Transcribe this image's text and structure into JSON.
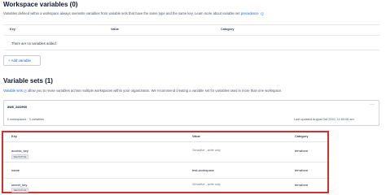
{
  "workspace_variables": {
    "title": "Workspace variables (0)",
    "description": "Variables defined within a workspace always overwrite variables from variable sets that have the same type and the same key. Learn more about variable set",
    "description_link": "precedence",
    "columns": [
      "Key",
      "Value",
      "Category"
    ],
    "empty_message": "There are no variables added.",
    "add_button": "+ Add variable"
  },
  "variable_sets": {
    "title": "Variable sets (1)",
    "description_link": "Variable sets",
    "description": "allow you to reuse variables across multiple workspaces within your organization. We recommend creating a variable set for variables used in more than one workspace.",
    "set": {
      "name": "aws_access",
      "summary": "2 workspaces · 3 variables",
      "last_updated": "Last updated August 3rd 2022, 11:50:06 am",
      "menu": "···"
    },
    "columns": [
      "Key",
      "Value",
      "Category"
    ],
    "rows": [
      {
        "key": "access_key",
        "badge": "SENSITIVE",
        "value": "Sensitive - write only",
        "value_sensitive": true,
        "category": "terraform"
      },
      {
        "key": "name",
        "badge": "",
        "value": "test-workspace",
        "value_sensitive": false,
        "category": "terraform"
      },
      {
        "key": "secret_key",
        "badge": "SENSITIVE",
        "value": "Sensitive - write only",
        "value_sensitive": true,
        "category": "terraform"
      }
    ]
  },
  "colors": {
    "link": "#1d5fd6",
    "highlight": "#d62d2d"
  }
}
